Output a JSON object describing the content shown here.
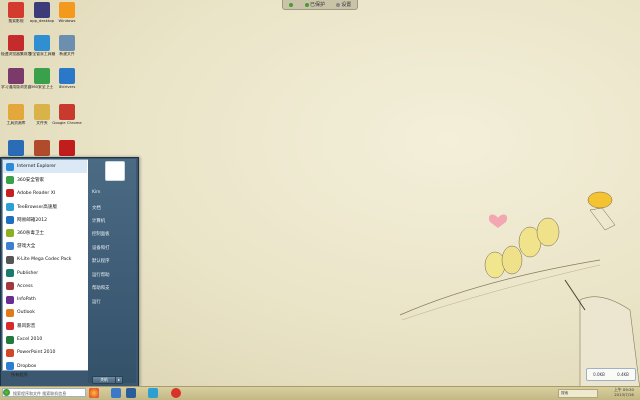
{
  "topbar": {
    "item1": "",
    "item2": "已保护",
    "item3": "设置"
  },
  "desktop_icons": [
    {
      "label": "搜索影视",
      "color": "#d53a2e"
    },
    {
      "label": "app_desktop",
      "color": "#3c3c7a"
    },
    {
      "label": "Windows",
      "color": "#f39a1e"
    },
    {
      "label": "极速浏览器集成包",
      "color": "#c52b2b"
    },
    {
      "label": "安全管家工具箱",
      "color": "#2f8fd0"
    },
    {
      "label": "新建文件",
      "color": "#6c8fb0"
    },
    {
      "label": "学习通用版浏览器",
      "color": "#7b3a6a"
    },
    {
      "label": "360安全卫士",
      "color": "#3aa14a"
    },
    {
      "label": "IEdrivers",
      "color": "#2b78c9"
    },
    {
      "label": "工具资源库",
      "color": "#e3a73b"
    },
    {
      "label": "文件夹",
      "color": "#d9b24a"
    },
    {
      "label": "Google Chrome",
      "color": "#c93a2e"
    },
    {
      "label": "",
      "color": "#2b6cb6"
    },
    {
      "label": "",
      "color": "#b04c2b"
    },
    {
      "label": "",
      "color": "#c21d1d"
    }
  ],
  "start_menu": {
    "programs": [
      {
        "label": "Internet Explorer",
        "color": "#2b8bd6"
      },
      {
        "label": "360安全管家",
        "color": "#3aa14a"
      },
      {
        "label": "Adobe Reader XI",
        "color": "#c71f1f"
      },
      {
        "label": "TeeBrowser高速版",
        "color": "#2aa0d5"
      },
      {
        "label": "网易邮箱2012",
        "color": "#1e6fbf"
      },
      {
        "label": "360杀毒卫士",
        "color": "#8ab21e"
      },
      {
        "label": "游戏大全",
        "color": "#3c7fcf"
      },
      {
        "label": "K-Lite Mega Codec Pack",
        "color": "#555555"
      },
      {
        "label": "Publisher",
        "color": "#1a7a6d"
      },
      {
        "label": "Access",
        "color": "#a4373a"
      },
      {
        "label": "InfoPath",
        "color": "#6a2c91"
      },
      {
        "label": "Outlook",
        "color": "#e07b1c"
      },
      {
        "label": "暴风影音",
        "color": "#d82a2a"
      },
      {
        "label": "Excel 2010",
        "color": "#1f7a3c"
      },
      {
        "label": "PowerPoint 2010",
        "color": "#d24726"
      },
      {
        "label": "Dropbox",
        "color": "#2a7fd4"
      }
    ],
    "all_programs": "所有程序",
    "right_links": [
      "Kim",
      "文档",
      "计算机",
      "控制面板",
      "设备和打",
      "默认程序",
      "运行帮助",
      "帮助和支",
      "运行"
    ],
    "shutdown": "关机"
  },
  "taskbar": {
    "search_placeholder": "搜索程序和文件 搜索联机信息",
    "tray_search": "搜索",
    "time": "上午 09:30",
    "date": "2013/7/16",
    "net_up": "0.0KB",
    "net_down": "0.4KB"
  }
}
